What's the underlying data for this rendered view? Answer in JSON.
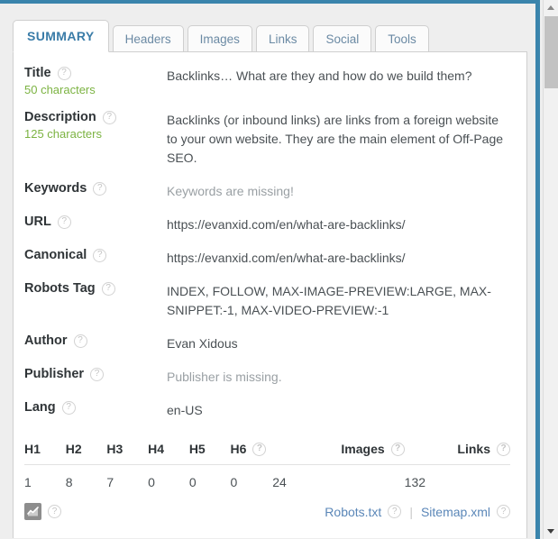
{
  "tabs": [
    {
      "label": "SUMMARY",
      "active": true
    },
    {
      "label": "Headers",
      "active": false
    },
    {
      "label": "Images",
      "active": false
    },
    {
      "label": "Links",
      "active": false
    },
    {
      "label": "Social",
      "active": false
    },
    {
      "label": "Tools",
      "active": false
    }
  ],
  "help_glyph": "?",
  "rows": [
    {
      "label": "Title",
      "sub": "50 characters",
      "value": "Backlinks… What are they and how do we build them?",
      "missing": false
    },
    {
      "label": "Description",
      "sub": "125 characters",
      "value": "Backlinks (or inbound links) are links from a foreign website to your own website. They are the main element of Off-Page SEO.",
      "missing": false
    },
    {
      "label": "Keywords",
      "sub": "",
      "value": "Keywords are missing!",
      "missing": true
    },
    {
      "label": "URL",
      "sub": "",
      "value": "https://evanxid.com/en/what-are-backlinks/",
      "missing": false
    },
    {
      "label": "Canonical",
      "sub": "",
      "value": "https://evanxid.com/en/what-are-backlinks/",
      "missing": false
    },
    {
      "label": "Robots Tag",
      "sub": "",
      "value": "INDEX, FOLLOW, MAX-IMAGE-PREVIEW:LARGE, MAX-SNIPPET:-1, MAX-VIDEO-PREVIEW:-1",
      "missing": false
    },
    {
      "label": "Author",
      "sub": "",
      "value": "Evan Xidous",
      "missing": false
    },
    {
      "label": "Publisher",
      "sub": "",
      "value": "Publisher is missing.",
      "missing": true
    },
    {
      "label": "Lang",
      "sub": "",
      "value": "en-US",
      "missing": false
    }
  ],
  "heading_table": {
    "headers": [
      "H1",
      "H2",
      "H3",
      "H4",
      "H5",
      "H6",
      "Images",
      "Links"
    ],
    "values": [
      "1",
      "8",
      "7",
      "0",
      "0",
      "0",
      "24",
      "132"
    ]
  },
  "footer": {
    "chart_icon_name": "chart-icon",
    "robots_link": "Robots.txt",
    "separator": "|",
    "sitemap_link": "Sitemap.xml"
  },
  "colors": {
    "accent_blue": "#3a84ac",
    "active_tab_text": "#3a7ca8",
    "tab_text": "#6b8aa4",
    "char_count_green": "#7cb342",
    "missing_gray": "#9aa0a4",
    "link_blue": "#5b87b8"
  }
}
